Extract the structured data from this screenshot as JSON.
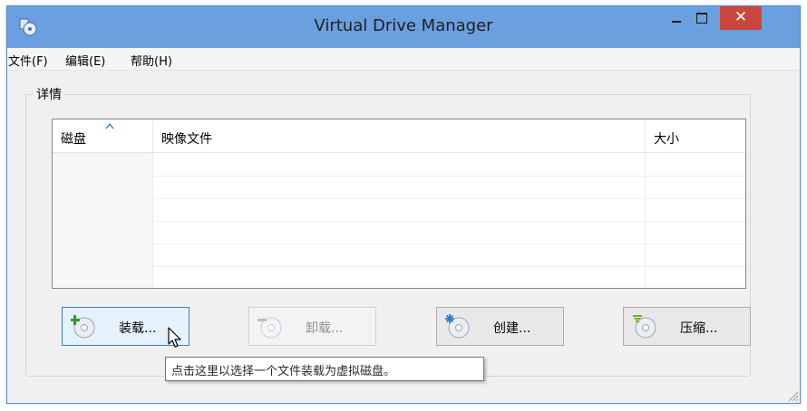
{
  "window": {
    "title": "Virtual Drive Manager",
    "close_symbol": "✕"
  },
  "menu": [
    "文件(F)",
    "编辑(E)",
    "帮助(H)"
  ],
  "group": {
    "legend": "详情"
  },
  "table": {
    "columns": [
      "磁盘",
      "映像文件",
      "大小"
    ],
    "sort_indicator": "^",
    "rows": [
      [],
      [],
      [],
      [],
      [],
      []
    ]
  },
  "buttons": {
    "mount": {
      "label": "装载...",
      "icon": "disc-add-icon",
      "state": "hover"
    },
    "unmount": {
      "label": "卸载...",
      "icon": "disc-remove-icon",
      "state": "disabled"
    },
    "create": {
      "label": "创建...",
      "icon": "disc-create-icon",
      "state": "normal"
    },
    "compress": {
      "label": "压缩...",
      "icon": "disc-compress-icon",
      "state": "normal"
    }
  },
  "tooltip": {
    "text": "点击这里以选择一个文件装载为虚拟磁盘。"
  },
  "colors": {
    "titlebar": "#6a9fe0",
    "close_button": "#c9463d",
    "button_hover": "#e5f1fb",
    "window_bg": "#f0f0f0"
  }
}
